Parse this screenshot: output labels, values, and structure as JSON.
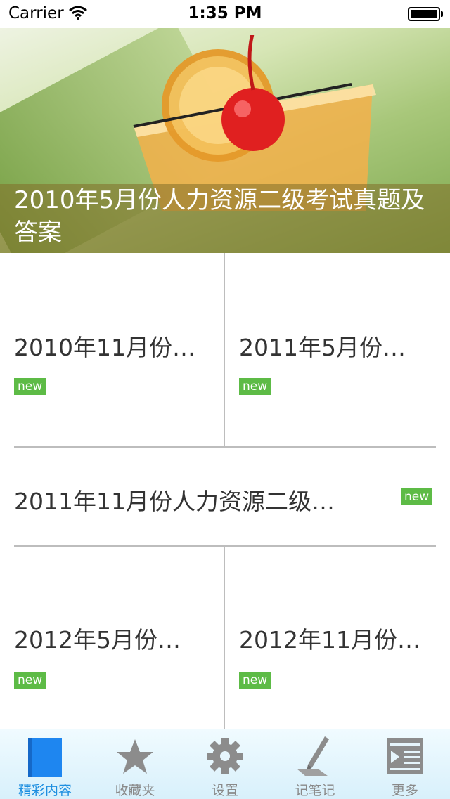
{
  "status_bar": {
    "carrier": "Carrier",
    "time": "1:35 PM"
  },
  "hero": {
    "caption": "2010年5月份人力资源二级考试真题及答案"
  },
  "items": [
    {
      "title": "2010年11月份…",
      "badge": "new"
    },
    {
      "title": "2011年5月份…",
      "badge": "new"
    },
    {
      "title": "2011年11月份人力资源二级…",
      "badge": "new"
    },
    {
      "title": "2012年5月份…",
      "badge": "new"
    },
    {
      "title": "2012年11月份…",
      "badge": "new"
    }
  ],
  "tabs": [
    {
      "label": "精彩内容",
      "icon": "book-icon",
      "active": true
    },
    {
      "label": "收藏夹",
      "icon": "star-icon"
    },
    {
      "label": "设置",
      "icon": "gear-icon"
    },
    {
      "label": "记笔记",
      "icon": "pen-icon"
    },
    {
      "label": "更多",
      "icon": "more-list-icon"
    }
  ],
  "colors": {
    "badge": "#5dbb46",
    "active_tab": "#1f8fe0",
    "inactive_tab": "#8a8a8a"
  }
}
